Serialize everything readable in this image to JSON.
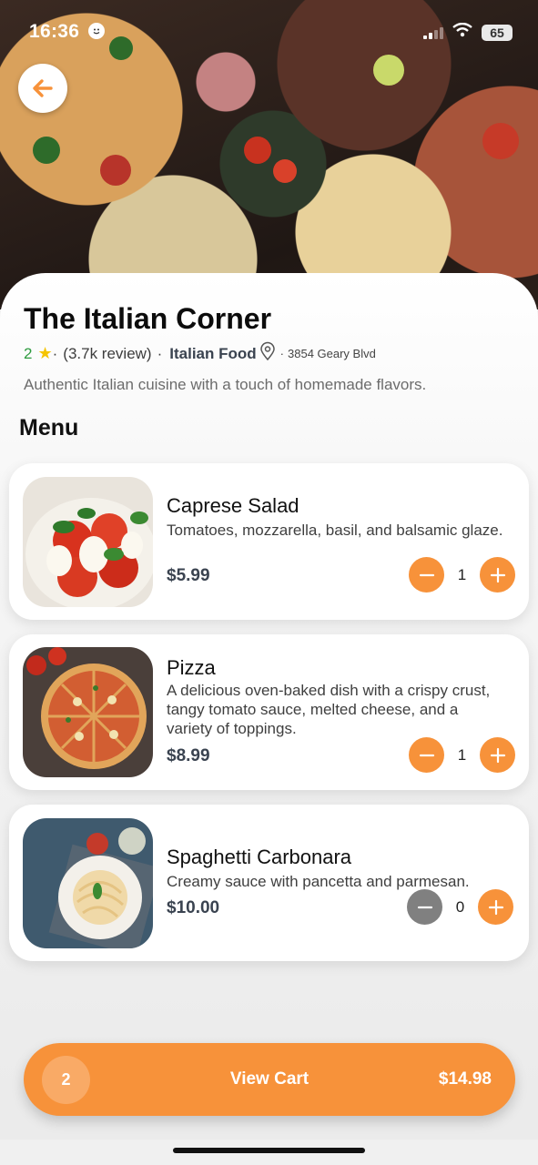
{
  "status_bar": {
    "time": "16:36",
    "battery": "65"
  },
  "restaurant": {
    "name": "The Italian Corner",
    "rating": "2",
    "reviews": "(3.7k review)",
    "separator": "·",
    "category": "Italian Food",
    "address": "3854 Geary Blvd",
    "description": "Authentic Italian cuisine with a touch of homemade flavors."
  },
  "menu": {
    "heading": "Menu",
    "items": [
      {
        "name": "Caprese Salad",
        "description": "Tomatoes, mozzarella, basil, and balsamic glaze.",
        "price": "$5.99",
        "quantity": "1"
      },
      {
        "name": "Pizza",
        "description": "A delicious oven-baked dish with a crispy crust, tangy tomato sauce, melted cheese, and a variety of toppings.",
        "price": "$8.99",
        "quantity": "1"
      },
      {
        "name": "Spaghetti Carbonara",
        "description": "Creamy sauce with pancetta and parmesan.",
        "price": "$10.00",
        "quantity": "0"
      }
    ]
  },
  "cart": {
    "count": "2",
    "label": "View Cart",
    "total": "$14.98"
  },
  "colors": {
    "accent": "#f7923a",
    "rating": "#2e9b3f",
    "star": "#f5c400",
    "disabled": "#808080"
  },
  "icons": [
    "back-arrow-icon",
    "star-icon",
    "location-pin-icon",
    "minus-icon",
    "plus-icon",
    "wifi-icon",
    "signal-icon",
    "battery-icon"
  ]
}
